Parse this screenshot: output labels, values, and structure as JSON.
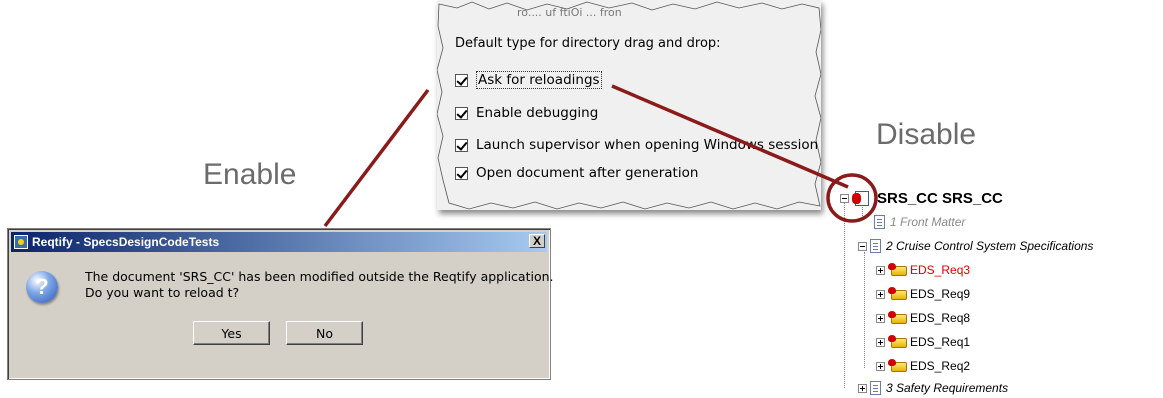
{
  "labels": {
    "enable": "Enable",
    "disable": "Disable"
  },
  "options_panel": {
    "faint_text": "ro....  uf ftiOi ...  fron",
    "heading": "Default type for directory drag and drop:",
    "options": [
      {
        "label": "Ask for reloadings",
        "checked": true
      },
      {
        "label": "Enable debugging",
        "checked": true
      },
      {
        "label": "Launch supervisor when opening Windows session",
        "checked": true
      },
      {
        "label": "Open document after generation",
        "checked": true
      }
    ]
  },
  "dialog": {
    "title": "Reqtify - SpecsDesignCodeTests",
    "close_glyph": "X",
    "icon_glyph": "?",
    "message_line1": "The document 'SRS_CC' has been modified outside the Reqtify application.",
    "message_line2": "Do you want to reload t?",
    "yes_label": "Yes",
    "no_label": "No"
  },
  "tree": {
    "root": "SRS_CC   SRS_CC",
    "items": [
      {
        "label": "1 Front Matter"
      },
      {
        "label": "2 Cruise Control System Specifications"
      },
      {
        "label": "EDS_Req3"
      },
      {
        "label": "EDS_Req9"
      },
      {
        "label": "EDS_Req8"
      },
      {
        "label": "EDS_Req1"
      },
      {
        "label": "EDS_Req2"
      },
      {
        "label": "3 Safety Requirements"
      }
    ]
  },
  "colors": {
    "connector": "#8b1a1a",
    "highlight_red": "#e00000",
    "dialog_title": "#0a246a"
  }
}
